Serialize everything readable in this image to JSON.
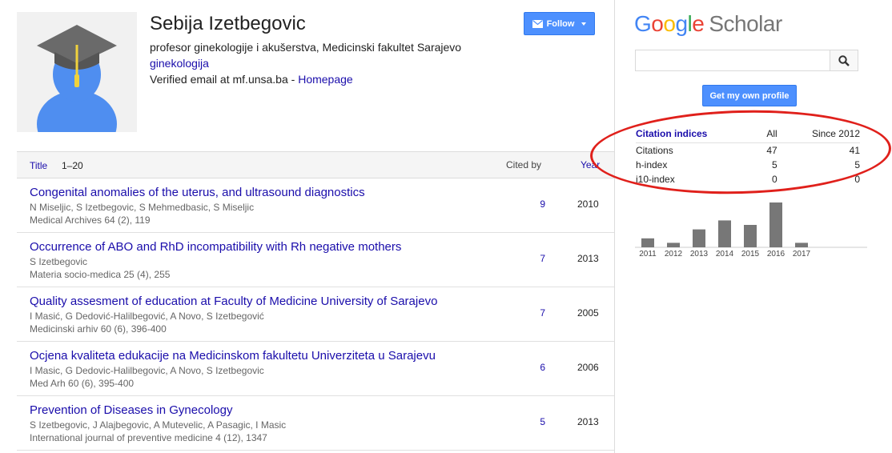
{
  "profile": {
    "name": "Sebija Izetbegovic",
    "affiliation": "profesor ginekologije i akušerstva, Medicinski fakultet Sarajevo",
    "interest": "ginekologija",
    "email_text": "Verified email at mf.unsa.ba - ",
    "homepage_label": "Homepage",
    "follow_label": "Follow"
  },
  "table": {
    "title_col": "Title",
    "range": "1–20",
    "cited_col": "Cited by",
    "year_col": "Year",
    "rows": [
      {
        "title": "Congenital anomalies of the uterus, and ultrasound diagnostics",
        "authors": "N Miseljic, S Izetbegovic, S Mehmedbasic, S Miseljic",
        "venue": "Medical Archives 64 (2), 119",
        "cited": "9",
        "year": "2010"
      },
      {
        "title": "Occurrence of ABO and RhD incompatibility with Rh negative mothers",
        "authors": "S Izetbegovic",
        "venue": "Materia socio-medica 25 (4), 255",
        "cited": "7",
        "year": "2013"
      },
      {
        "title": "Quality assesment of education at Faculty of Medicine University of Sarajevo",
        "authors": "I Masić, G Dedović-Halilbegović, A Novo, S Izetbegović",
        "venue": "Medicinski arhiv 60 (6), 396-400",
        "cited": "7",
        "year": "2005"
      },
      {
        "title": "Ocjena kvaliteta edukacije na Medicinskom fakultetu Univerziteta u Sarajevu",
        "authors": "I Masic, G Dedovic-Halilbegovic, A Novo, S Izetbegovic",
        "venue": "Med Arh 60 (6), 395-400",
        "cited": "6",
        "year": "2006"
      },
      {
        "title": "Prevention of Diseases in Gynecology",
        "authors": "S Izetbegovic, J Alajbegovic, A Mutevelic, A Pasagic, I Masic",
        "venue": "International journal of preventive medicine 4 (12), 1347",
        "cited": "5",
        "year": "2013"
      }
    ]
  },
  "sidebar": {
    "logo_google": "Google",
    "logo_scholar": "Scholar",
    "search_placeholder": "",
    "get_profile_label": "Get my own profile",
    "citation_header": "Citation indices",
    "col_all": "All",
    "col_since": "Since 2012",
    "metrics": [
      {
        "label": "Citations",
        "all": "47",
        "since": "41"
      },
      {
        "label": "h-index",
        "all": "5",
        "since": "5"
      },
      {
        "label": "i10-index",
        "all": "0",
        "since": "0"
      }
    ]
  },
  "chart_data": {
    "type": "bar",
    "categories": [
      "2011",
      "2012",
      "2013",
      "2014",
      "2015",
      "2016",
      "2017"
    ],
    "values": [
      2,
      1,
      4,
      6,
      5,
      10,
      1
    ]
  },
  "colors": {
    "link": "#1a0dab",
    "button_blue": "#4d90fe",
    "bar": "#777777",
    "annotation_red": "#e0201b"
  }
}
